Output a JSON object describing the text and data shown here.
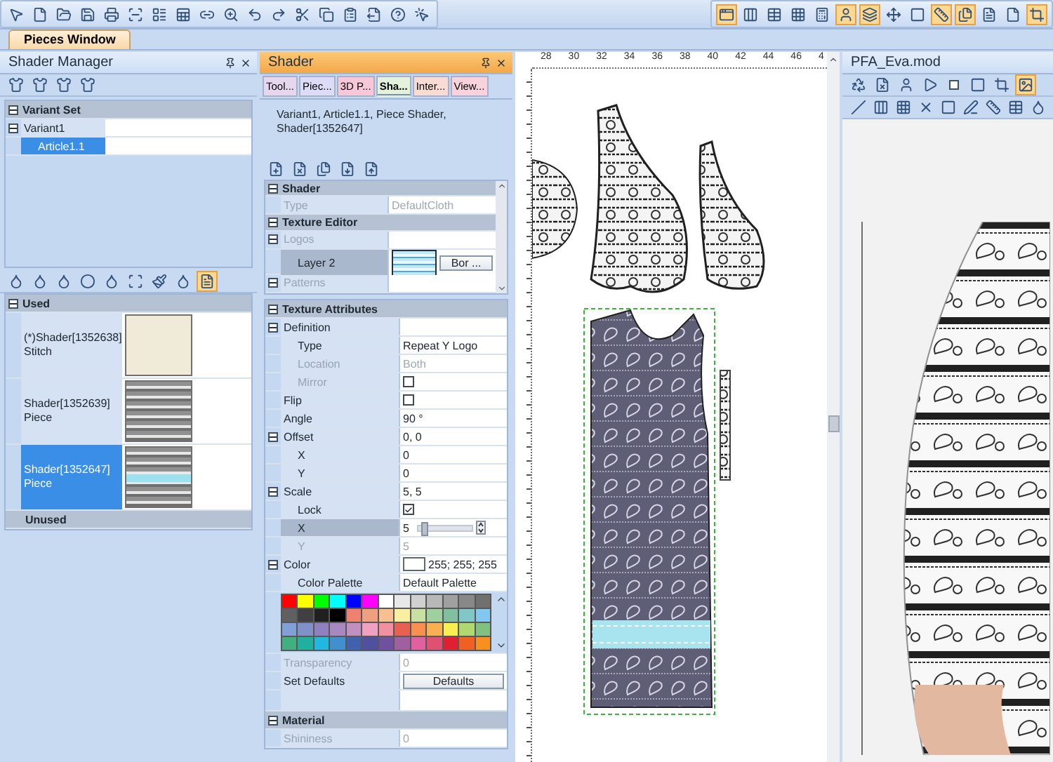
{
  "toolbar_right": [
    {
      "selected": true
    },
    {
      "selected": false
    },
    {
      "selected": false
    },
    {
      "selected": false
    },
    {
      "selected": false
    },
    {
      "selected": true
    },
    {
      "selected": true
    },
    {
      "selected": false
    },
    {
      "selected": false
    },
    {
      "selected": true
    },
    {
      "selected": true
    },
    {
      "selected": false
    },
    {
      "selected": false
    },
    {
      "selected": true
    }
  ],
  "document_tab": "Pieces Window",
  "shader_manager": {
    "title": "Shader Manager",
    "variant_set": {
      "label": "Variant Set",
      "expanded": true,
      "items": [
        {
          "label": "Variant1",
          "expanded": true,
          "selected": false,
          "children": [
            {
              "label": "Article1.1",
              "selected": true
            }
          ]
        }
      ]
    },
    "used": {
      "label": "Used",
      "expanded": true,
      "items": [
        {
          "name": "(*)Shader[1352638]",
          "type": "Stitch",
          "selected": false,
          "kind": "plain"
        },
        {
          "name": "Shader[1352639]",
          "type": "Piece",
          "selected": false,
          "kind": "pattern"
        },
        {
          "name": "Shader[1352647]",
          "type": "Piece",
          "selected": true,
          "kind": "banded"
        }
      ]
    },
    "unused": {
      "label": "Unused"
    }
  },
  "shader_panel": {
    "title": "Shader",
    "tabs": [
      {
        "label": "Tool...",
        "selected": false,
        "color": "#e6d6ee"
      },
      {
        "label": "Piec...",
        "selected": false,
        "color": "#dcdcf8"
      },
      {
        "label": "3D P...",
        "selected": false,
        "color": "#f8c8d8"
      },
      {
        "label": "Sha...",
        "selected": true,
        "color": "#e4f2dc"
      },
      {
        "label": "Inter...",
        "selected": false,
        "color": "#f8dcd4"
      },
      {
        "label": "View...",
        "selected": false,
        "color": "#f8d2dc"
      }
    ],
    "path": "Variant1, Article1.1, Piece Shader, Shader[1352647]",
    "top_grid": [
      {
        "label": "Shader",
        "expanded": true,
        "rows": [
          {
            "kind": "text",
            "label": "Type",
            "value": "DefaultCloth",
            "disabled": true,
            "selected": false
          }
        ]
      },
      {
        "label": "Texture Editor",
        "expanded": true,
        "rows": [
          {
            "kind": "text",
            "label": "Logos",
            "disabled": true,
            "selected": false,
            "expanded": true,
            "children": [
              {
                "kind": "swatch",
                "label": "Layer  2",
                "value": "Bor ...",
                "disabled": false,
                "selected": true
              }
            ]
          },
          {
            "kind": "text",
            "label": "Patterns",
            "disabled": true,
            "selected": false,
            "expanded": true
          }
        ]
      }
    ],
    "bottom_grid": [
      {
        "label": "Texture Attributes",
        "expanded": true,
        "rows": [
          {
            "kind": "text",
            "label": "Definition",
            "disabled": false,
            "selected": false,
            "expanded": true,
            "children": [
              {
                "kind": "text",
                "label": "Type",
                "value": "Repeat Y Logo",
                "disabled": false,
                "selected": false
              },
              {
                "kind": "text",
                "label": "Location",
                "value": "Both",
                "disabled": true,
                "selected": false
              },
              {
                "kind": "checkbox",
                "label": "Mirror",
                "checked": false,
                "disabled": true,
                "selected": false
              }
            ]
          },
          {
            "kind": "checkbox",
            "label": "Flip",
            "checked": false,
            "disabled": false,
            "selected": false
          },
          {
            "kind": "text",
            "label": "Angle",
            "value": "90 °",
            "disabled": false,
            "selected": false
          },
          {
            "kind": "text",
            "label": "Offset",
            "value": "0, 0",
            "disabled": false,
            "selected": false,
            "expanded": true,
            "children": [
              {
                "kind": "text",
                "label": "X",
                "value": "0",
                "disabled": false,
                "selected": false
              },
              {
                "kind": "text",
                "label": "Y",
                "value": "0",
                "disabled": false,
                "selected": false
              }
            ]
          },
          {
            "kind": "text",
            "label": "Scale",
            "value": "5, 5",
            "disabled": false,
            "selected": false,
            "expanded": true,
            "children": [
              {
                "kind": "checkbox",
                "label": "Lock",
                "checked": true,
                "disabled": false,
                "selected": false
              },
              {
                "kind": "slider",
                "label": "X",
                "value": "5",
                "level": 0.05,
                "disabled": false,
                "selected": true
              },
              {
                "kind": "text",
                "label": "Y",
                "value": "5",
                "disabled": true,
                "selected": false
              }
            ]
          },
          {
            "kind": "color",
            "label": "Color",
            "value": "255; 255; 255",
            "color": "#ffffff",
            "disabled": false,
            "selected": false,
            "expanded": true,
            "children": [
              {
                "kind": "text",
                "label": "Color Palette",
                "value": "Default Palette",
                "disabled": false,
                "selected": false
              },
              {
                "kind": "palette",
                "colors": [
                  {
                    "color": "#ff0000"
                  },
                  {
                    "color": "#ffff00"
                  },
                  {
                    "color": "#00ff00"
                  },
                  {
                    "color": "#00ffff"
                  },
                  {
                    "color": "#0000ff"
                  },
                  {
                    "color": "#ff00ff"
                  },
                  {
                    "color": "#ffffff"
                  },
                  {
                    "color": "#e8e8e8"
                  },
                  {
                    "color": "#d0d0d0"
                  },
                  {
                    "color": "#b8b8b8"
                  },
                  {
                    "color": "#a0a0a0"
                  },
                  {
                    "color": "#888888"
                  },
                  {
                    "color": "#707070"
                  },
                  {
                    "color": "#606060"
                  },
                  {
                    "color": "#404040"
                  },
                  {
                    "color": "#202020"
                  },
                  {
                    "color": "#000000"
                  },
                  {
                    "color": "#f08070"
                  },
                  {
                    "color": "#f0a080"
                  },
                  {
                    "color": "#f8c090"
                  },
                  {
                    "color": "#f8f0a0"
                  },
                  {
                    "color": "#c8e0a0"
                  },
                  {
                    "color": "#a0d0a0"
                  },
                  {
                    "color": "#80c0a0"
                  },
                  {
                    "color": "#80c8c8"
                  },
                  {
                    "color": "#80c8f0"
                  },
                  {
                    "color": "#80a0d8"
                  },
                  {
                    "color": "#8090c8"
                  },
                  {
                    "color": "#9080c0"
                  },
                  {
                    "color": "#a888c0"
                  },
                  {
                    "color": "#c090c0"
                  },
                  {
                    "color": "#f0a0c0"
                  },
                  {
                    "color": "#f090a0"
                  },
                  {
                    "color": "#e86050"
                  },
                  {
                    "color": "#f89050"
                  },
                  {
                    "color": "#f8b050"
                  },
                  {
                    "color": "#f8f050"
                  },
                  {
                    "color": "#b0d870"
                  },
                  {
                    "color": "#80c080"
                  },
                  {
                    "color": "#40b080"
                  },
                  {
                    "color": "#20b0a0"
                  },
                  {
                    "color": "#20b8e0"
                  },
                  {
                    "color": "#4090d0"
                  },
                  {
                    "color": "#4060b0"
                  },
                  {
                    "color": "#5050a0"
                  },
                  {
                    "color": "#7050a0"
                  },
                  {
                    "color": "#a060a0"
                  },
                  {
                    "color": "#e060a0"
                  },
                  {
                    "color": "#e05070"
                  },
                  {
                    "color": "#e02030"
                  },
                  {
                    "color": "#f06020"
                  },
                  {
                    "color": "#f89020"
                  }
                ]
              }
            ]
          },
          {
            "kind": "text",
            "label": "Transparency",
            "value": "0",
            "disabled": true,
            "selected": false
          },
          {
            "kind": "button",
            "label": "Set Defaults",
            "value": "Defaults",
            "disabled": false,
            "selected": false
          }
        ]
      },
      {
        "label": "Material",
        "expanded": true,
        "rows": [
          {
            "kind": "text",
            "label": "Shininess",
            "value": "0",
            "disabled": true,
            "selected": false
          }
        ]
      }
    ]
  },
  "canvas": {
    "ruler_labels": [
      "28",
      "30",
      "32",
      "34",
      "36",
      "38",
      "40",
      "42",
      "44",
      "46",
      "4"
    ]
  },
  "model_view": {
    "title": "PFA_Eva.mod"
  }
}
